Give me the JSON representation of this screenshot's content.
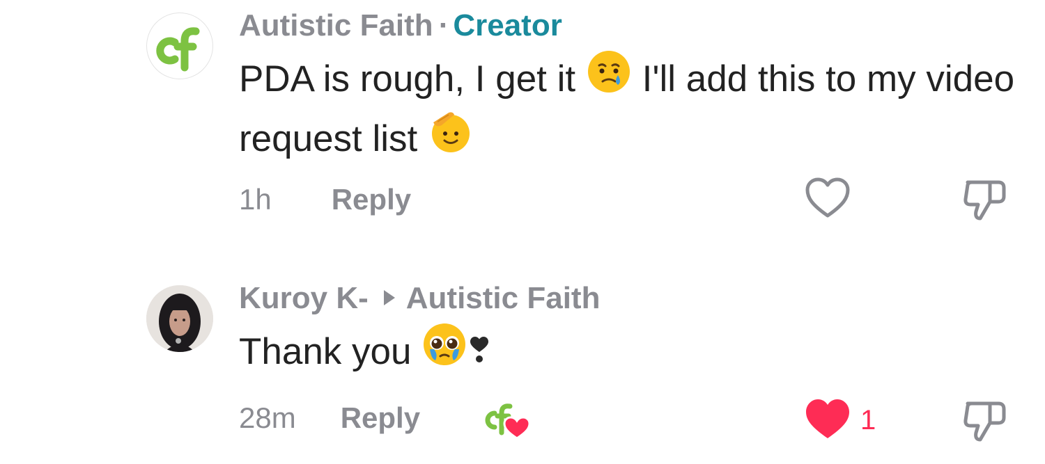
{
  "comments": [
    {
      "author": "Autistic Faith",
      "separator": "·",
      "badge": "Creator",
      "text_part1": "PDA is rough, I get it",
      "text_part2": "I'll add this to my video request list",
      "emojis": [
        "face-holding-back-tears-icon",
        "saluting-face-icon"
      ],
      "time": "1h",
      "reply_label": "Reply",
      "liked": false,
      "like_count": ""
    },
    {
      "author": "Kuroy K-",
      "reply_to": "Autistic Faith",
      "text": "Thank you",
      "emojis": [
        "pleading-face-icon",
        "heart-exclamation-icon"
      ],
      "time": "28m",
      "reply_label": "Reply",
      "liked_by_creator": true,
      "liked": true,
      "like_count": "1"
    }
  ],
  "colors": {
    "creator_badge": "#1a8a9c",
    "muted": "#8a8b91",
    "like_active": "#fe2c55",
    "brand_green": "#7dc242"
  }
}
